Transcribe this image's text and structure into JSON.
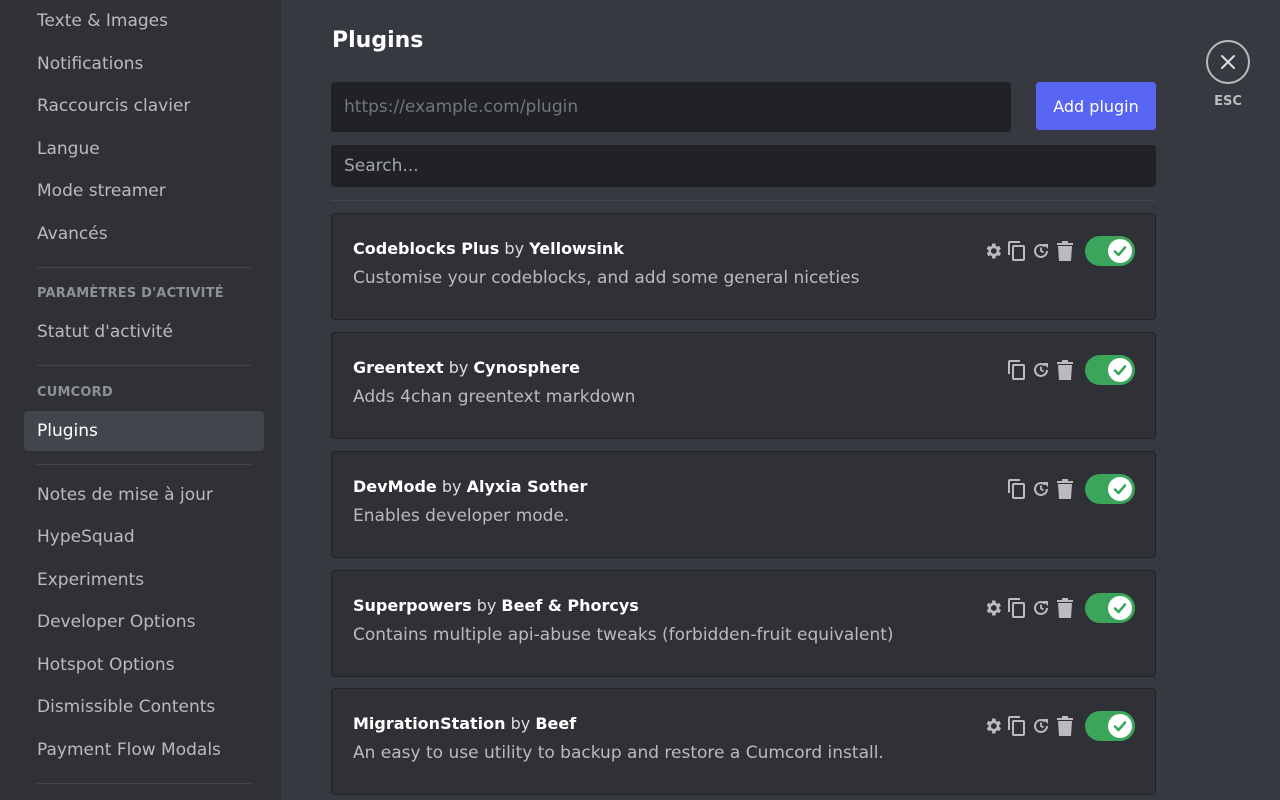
{
  "sidebar": {
    "items": [
      {
        "label": "Texte & Images"
      },
      {
        "label": "Notifications"
      },
      {
        "label": "Raccourcis clavier"
      },
      {
        "label": "Langue"
      },
      {
        "label": "Mode streamer"
      },
      {
        "label": "Avancés"
      },
      {
        "label": "Statut d'activité"
      },
      {
        "label": "Plugins"
      },
      {
        "label": "Notes de mise à jour"
      },
      {
        "label": "HypeSquad"
      },
      {
        "label": "Experiments"
      },
      {
        "label": "Developer Options"
      },
      {
        "label": "Hotspot Options"
      },
      {
        "label": "Dismissible Contents"
      },
      {
        "label": "Payment Flow Modals"
      }
    ],
    "headers": {
      "activity": "PARAMÈTRES D'ACTIVITÉ",
      "cumcord": "CUMCORD"
    }
  },
  "main": {
    "title": "Plugins",
    "url_input": {
      "value": "",
      "placeholder": "https://example.com/plugin"
    },
    "add_button": "Add plugin",
    "search_input": {
      "value": "",
      "placeholder": "Search..."
    },
    "by_label": "by",
    "plugins": [
      {
        "name": "Codeblocks Plus",
        "author": "Yellowsink",
        "description": "Customise your codeblocks, and add some general niceties",
        "has_settings": true,
        "enabled": true
      },
      {
        "name": "Greentext",
        "author": "Cynosphere",
        "description": "Adds 4chan greentext markdown",
        "has_settings": false,
        "enabled": true
      },
      {
        "name": "DevMode",
        "author": "Alyxia Sother",
        "description": "Enables developer mode.",
        "has_settings": false,
        "enabled": true
      },
      {
        "name": "Superpowers",
        "author": "Beef & Phorcys",
        "description": "Contains multiple api-abuse tweaks (forbidden-fruit equivalent)",
        "has_settings": true,
        "enabled": true
      },
      {
        "name": "MigrationStation",
        "author": "Beef",
        "description": "An easy to use utility to backup and restore a Cumcord install.",
        "has_settings": true,
        "enabled": true
      }
    ]
  },
  "close": {
    "label": "ESC"
  },
  "colors": {
    "accent": "#5865f2",
    "toggle_on": "#3ba55c",
    "background": "#36393f",
    "sidebar": "#2f3136"
  },
  "icons": {
    "settings": "gear-icon",
    "copy": "copy-icon",
    "reload": "reload-icon",
    "delete": "trash-icon",
    "close": "close-icon",
    "toggle": "check-icon"
  }
}
